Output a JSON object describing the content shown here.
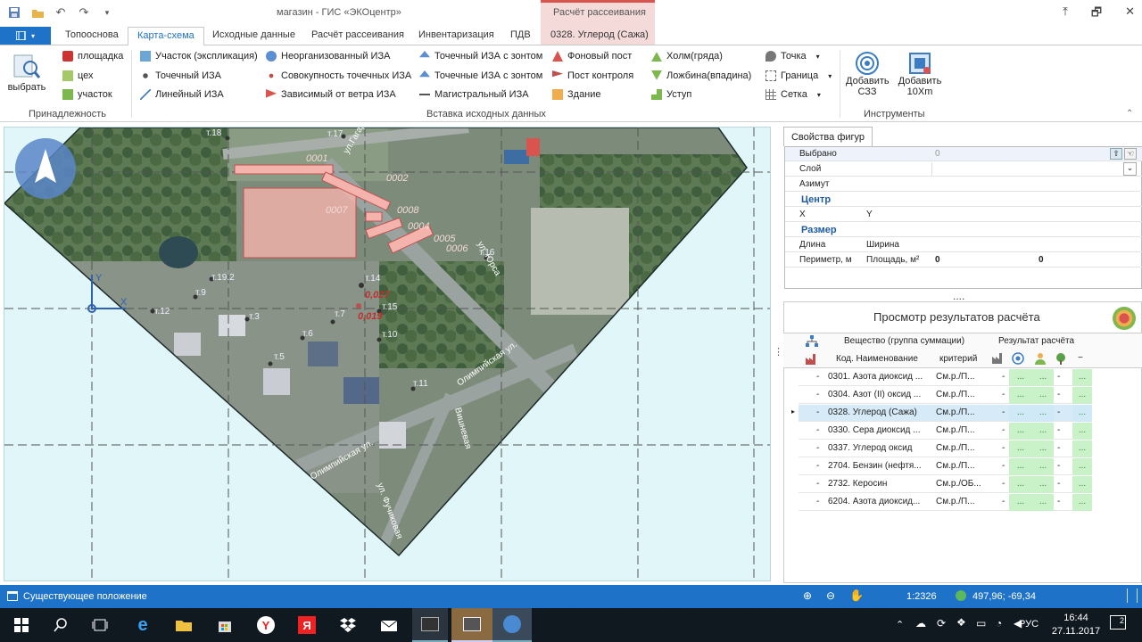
{
  "window": {
    "app_title": "магазин - ГИС «ЭКОцентр»",
    "context_group": "Расчёт рассеивания",
    "controls": [
      "⤒",
      "🗗",
      "✕"
    ]
  },
  "tabs": [
    {
      "label": "Топооснова",
      "active": false
    },
    {
      "label": "Карта-схема",
      "active": true
    },
    {
      "label": "Исходные данные",
      "active": false
    },
    {
      "label": "Расчёт рассеивания",
      "active": false
    },
    {
      "label": "Инвентаризация",
      "active": false
    },
    {
      "label": "ПДВ",
      "active": false
    },
    {
      "label": "0328. Углерод (Сажа)",
      "active": false
    }
  ],
  "ribbon": {
    "select_label": "выбрать",
    "belonging": {
      "items": [
        "площадка",
        "цех",
        "участок"
      ],
      "title": "Принадлежность"
    },
    "insert": {
      "col1": [
        "Участок (экспликация)",
        "Точечный ИЗА",
        "Линейный ИЗА"
      ],
      "col2": [
        "Неорганизованный ИЗА",
        "Совокупность точечных ИЗА",
        "Зависимый от ветра ИЗА"
      ],
      "col3": [
        "Точечный ИЗА с зонтом",
        "Точечные ИЗА с зонтом",
        "Магистральный ИЗА"
      ],
      "col4": [
        "Фоновый пост",
        "Пост контроля",
        "Здание"
      ],
      "col5": [
        "Холм(гряда)",
        "Ложбина(впадина)",
        "Уступ"
      ],
      "col6": [
        "Точка",
        "Граница",
        "Сетка"
      ],
      "title": "Вставка исходных данных"
    },
    "tools": {
      "btn1": "Добавить СЗЗ",
      "btn2": "Добавить 10Xm",
      "title": "Инструменты"
    }
  },
  "map": {
    "sources": [
      "0001",
      "0002",
      "0007",
      "0008",
      "0004",
      "0005",
      "0006"
    ],
    "points": [
      "т.18",
      "т.17",
      "т.16",
      "т.19.2",
      "т.9",
      "т.14",
      "т.12",
      "т.3",
      "т.7",
      "т.15",
      "т.6",
      "т.10",
      "т.5",
      "т.11"
    ],
    "values": [
      "0,027",
      "0,019"
    ],
    "streets": [
      "ул.Гагарина",
      "ул. Юрса",
      "Олимпийская ул.",
      "Олимпийская ул.",
      "ул. Фучиковая",
      "Вишневая"
    ],
    "axis_x": "X",
    "axis_y": "Y"
  },
  "props": {
    "tab": "Свойства фигур",
    "selected_label": "Выбрано",
    "selected_value": "0",
    "layer_label": "Слой",
    "azimuth_label": "Азимут",
    "center_label": "Центр",
    "x_label": "X",
    "y_label": "Y",
    "size_label": "Размер",
    "length_label": "Длина",
    "width_label": "Ширина",
    "perimeter_label": "Периметр, м",
    "area_label": "Площадь, м²",
    "perimeter_value": "0",
    "area_value": "0"
  },
  "results": {
    "title": "Просмотр результатов расчёта",
    "col_substance": "Вещество (группа суммации)",
    "col_result": "Результат расчёта",
    "col_code": "Код. Наименование",
    "col_criterion": "критерий",
    "dash": "-",
    "rows": [
      {
        "code": "0301. Азота диоксид ...",
        "crit": "См.р./П...",
        "selected": false
      },
      {
        "code": "0304. Азот (II) оксид ...",
        "crit": "См.р./П...",
        "selected": false
      },
      {
        "code": "0328. Углерод (Сажа)",
        "crit": "См.р./П...",
        "selected": true
      },
      {
        "code": "0330. Сера диоксид ...",
        "crit": "См.р./П...",
        "selected": false
      },
      {
        "code": "0337. Углерод оксид",
        "crit": "См.р./П...",
        "selected": false
      },
      {
        "code": "2704. Бензин (нефтя...",
        "crit": "См.р./П...",
        "selected": false
      },
      {
        "code": "2732. Керосин",
        "crit": "См.р./ОБ...",
        "selected": false
      },
      {
        "code": "6204. Азота диоксид...",
        "crit": "См.р./П...",
        "selected": false
      }
    ],
    "ellipsis": "..."
  },
  "status": {
    "text": "Существующее положение",
    "scale": "1:2326",
    "coords": "497,96; -69,34"
  },
  "taskbar": {
    "lang": "РУС",
    "time": "16:44",
    "date": "27.11.2017",
    "notif": "2"
  }
}
